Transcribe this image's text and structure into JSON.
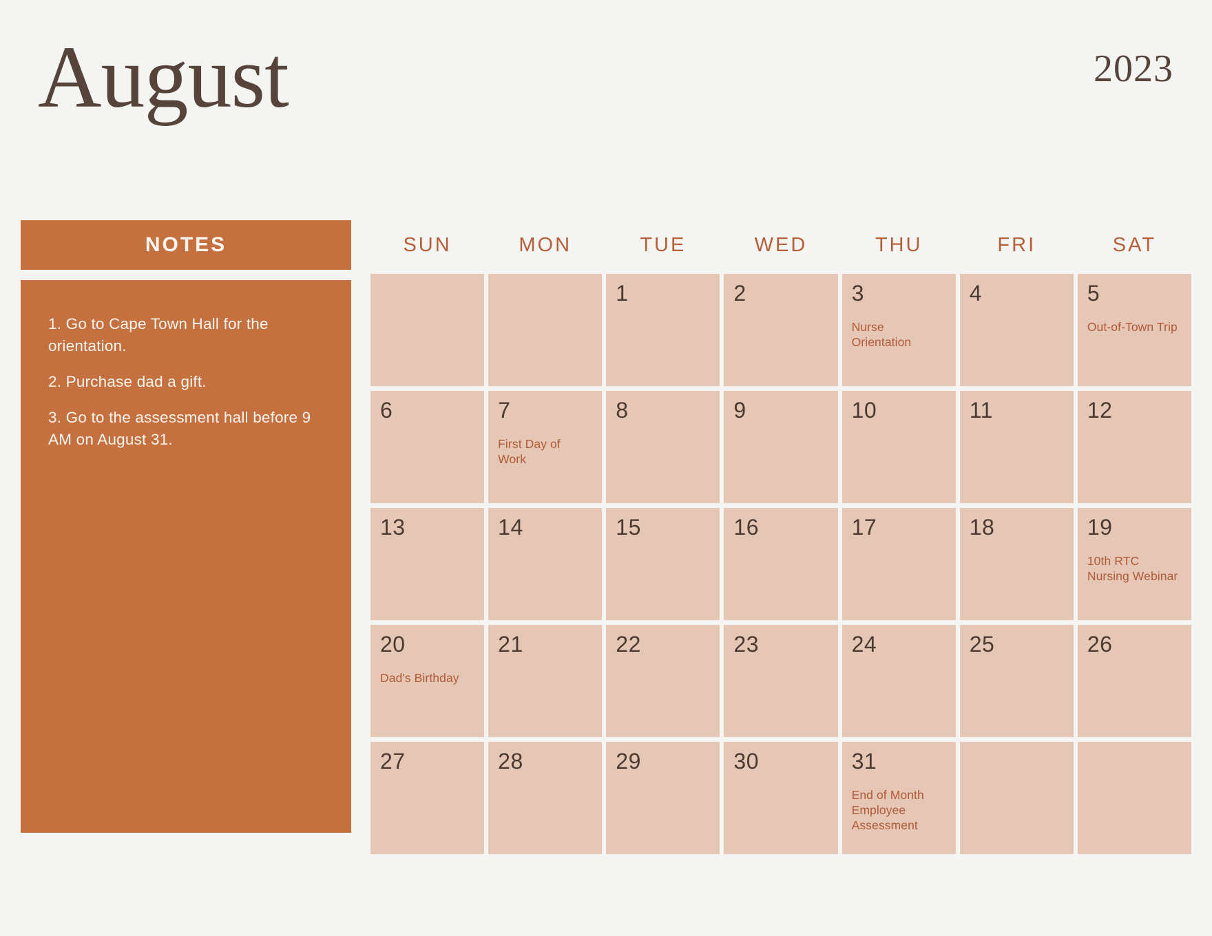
{
  "header": {
    "month": "August",
    "year": "2023"
  },
  "notes": {
    "title": "NOTES",
    "items": [
      "1. Go to Cape Town Hall for the orientation.",
      "2. Purchase dad a gift.",
      "3. Go to the assessment hall before 9 AM on August 31."
    ]
  },
  "calendar": {
    "weekdays": [
      "SUN",
      "MON",
      "TUE",
      "WED",
      "THU",
      "FRI",
      "SAT"
    ],
    "cells": [
      {
        "day": "",
        "event": ""
      },
      {
        "day": "",
        "event": ""
      },
      {
        "day": "1",
        "event": ""
      },
      {
        "day": "2",
        "event": ""
      },
      {
        "day": "3",
        "event": "Nurse Orientation"
      },
      {
        "day": "4",
        "event": ""
      },
      {
        "day": "5",
        "event": "Out-of-Town Trip"
      },
      {
        "day": "6",
        "event": ""
      },
      {
        "day": "7",
        "event": "First Day of Work"
      },
      {
        "day": "8",
        "event": ""
      },
      {
        "day": "9",
        "event": ""
      },
      {
        "day": "10",
        "event": ""
      },
      {
        "day": "11",
        "event": ""
      },
      {
        "day": "12",
        "event": ""
      },
      {
        "day": "13",
        "event": ""
      },
      {
        "day": "14",
        "event": ""
      },
      {
        "day": "15",
        "event": ""
      },
      {
        "day": "16",
        "event": ""
      },
      {
        "day": "17",
        "event": ""
      },
      {
        "day": "18",
        "event": ""
      },
      {
        "day": "19",
        "event": "10th RTC Nursing Webinar"
      },
      {
        "day": "20",
        "event": "Dad's Birthday"
      },
      {
        "day": "21",
        "event": ""
      },
      {
        "day": "22",
        "event": ""
      },
      {
        "day": "23",
        "event": ""
      },
      {
        "day": "24",
        "event": ""
      },
      {
        "day": "25",
        "event": ""
      },
      {
        "day": "26",
        "event": ""
      },
      {
        "day": "27",
        "event": ""
      },
      {
        "day": "28",
        "event": ""
      },
      {
        "day": "29",
        "event": ""
      },
      {
        "day": "30",
        "event": ""
      },
      {
        "day": "31",
        "event": "End of Month Employee Assessment"
      },
      {
        "day": "",
        "event": ""
      },
      {
        "day": "",
        "event": ""
      }
    ]
  },
  "colors": {
    "page_background": "#F4F4F2",
    "accent_terracotta": "#C4703F",
    "day_cell_background": "#E6C7B6",
    "title_brown": "#56433A",
    "event_text": "#B05A35",
    "weekday_text": "#B4603A",
    "notes_text": "#FBF4EF"
  }
}
